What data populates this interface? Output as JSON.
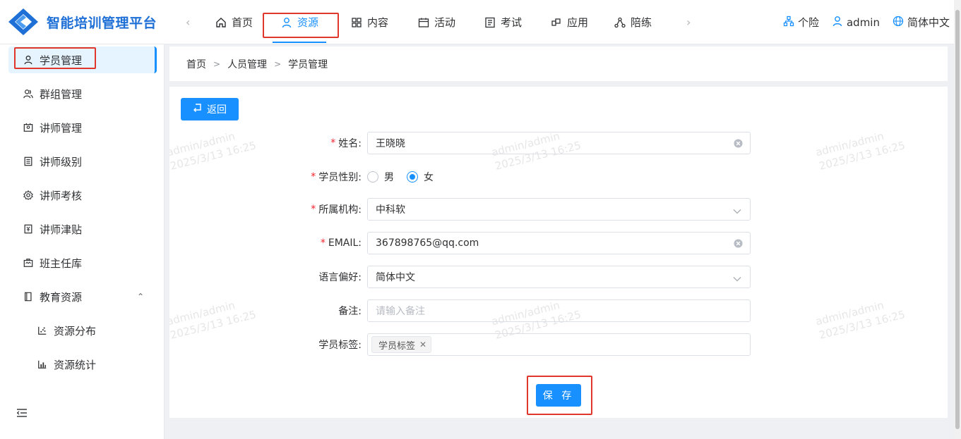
{
  "app": {
    "title": "智能培训管理平台",
    "accent_color": "#1890ff",
    "logo_color": "#1e6fd6"
  },
  "topnav": {
    "items": [
      {
        "label": "首页",
        "icon": "home-icon"
      },
      {
        "label": "资源",
        "icon": "user-icon",
        "active": true
      },
      {
        "label": "内容",
        "icon": "grid-icon"
      },
      {
        "label": "活动",
        "icon": "calendar-icon"
      },
      {
        "label": "考试",
        "icon": "exam-icon"
      },
      {
        "label": "应用",
        "icon": "apps-icon"
      },
      {
        "label": "陪练",
        "icon": "network-icon"
      }
    ],
    "right": {
      "org": "个险",
      "user": "admin",
      "language": "简体中文"
    }
  },
  "sidebar": {
    "items": [
      {
        "label": "学员管理",
        "icon": "user-icon",
        "active": true
      },
      {
        "label": "群组管理",
        "icon": "group-icon"
      },
      {
        "label": "讲师管理",
        "icon": "lecturer-icon"
      },
      {
        "label": "讲师级别",
        "icon": "level-icon"
      },
      {
        "label": "讲师考核",
        "icon": "gear-icon"
      },
      {
        "label": "讲师津贴",
        "icon": "allowance-icon"
      },
      {
        "label": "班主任库",
        "icon": "briefcase-icon"
      },
      {
        "label": "教育资源",
        "icon": "book-icon",
        "expanded": true
      },
      {
        "label": "资源分布",
        "icon": "scatter-chart-icon",
        "sub": true
      },
      {
        "label": "资源统计",
        "icon": "bar-chart-icon",
        "sub": true
      }
    ]
  },
  "breadcrumb": [
    "首页",
    "人员管理",
    "学员管理"
  ],
  "form": {
    "back_label": "返回",
    "save_label": "保 存",
    "fields": {
      "name": {
        "label": "姓名:",
        "required": true,
        "value": "王晓晓"
      },
      "gender": {
        "label": "学员性别:",
        "required": true,
        "options": [
          "男",
          "女"
        ],
        "selected": "女"
      },
      "org": {
        "label": "所属机构:",
        "required": true,
        "value": "中科软"
      },
      "email": {
        "label": "EMAIL:",
        "required": true,
        "value": "367898765@qq.com"
      },
      "language": {
        "label": "语言偏好:",
        "required": false,
        "value": "简体中文"
      },
      "remark": {
        "label": "备注:",
        "required": false,
        "value": "",
        "placeholder": "请输入备注"
      },
      "tags": {
        "label": "学员标签:",
        "required": false,
        "values": [
          "学员标签"
        ]
      }
    }
  },
  "watermark": {
    "line1": "admin/admin",
    "line2": "2025/3/13 16:25"
  }
}
